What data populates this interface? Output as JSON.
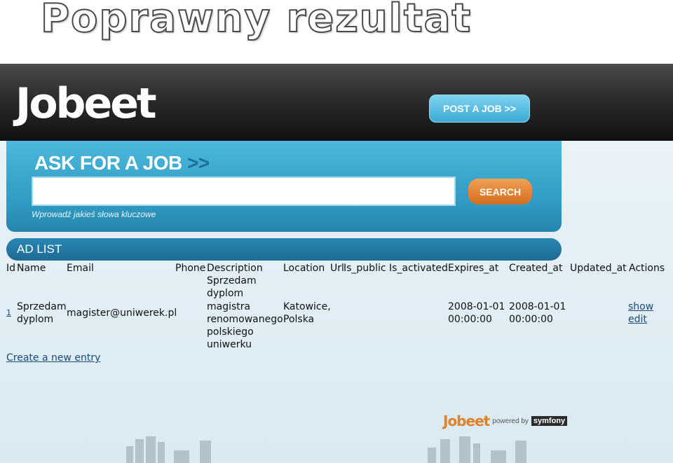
{
  "slide": {
    "title": "Poprawny rezultat"
  },
  "header": {
    "logo": "Jobeet",
    "post_job_label": "POST A JOB >>"
  },
  "search": {
    "title": "ASK FOR A JOB",
    "arrows": ">>",
    "input_value": "",
    "button_label": "SEARCH",
    "hint": "Wprowadź jakieś słowa kluczowe"
  },
  "ad_list": {
    "title": "AD LIST",
    "columns": [
      "Id",
      "Name",
      "Email",
      "Phone",
      "Description",
      "Location",
      "Url",
      "Is_public",
      "Is_activated",
      "Expires_at",
      "Created_at",
      "Updated_at",
      "Actions"
    ],
    "rows": [
      {
        "id": "1",
        "name_line1": "Sprzedam",
        "name_line2": "dyplom",
        "email": "magister@uniwerek.pl",
        "phone": "",
        "description_lines": [
          "Sprzedam",
          "dyplom",
          "magistra",
          "renomowanego",
          "polskiego",
          "uniwerku"
        ],
        "location_line1": "Katowice,",
        "location_line2": "Polska",
        "url": "",
        "is_public": "",
        "is_activated": "",
        "expires_line1": "2008-01-01",
        "expires_line2": "00:00:00",
        "created_line1": "2008-01-01",
        "created_line2": "00:00:00",
        "updated_at": "",
        "action_show": "show",
        "action_edit": "edit"
      }
    ],
    "create_link": "Create a new entry"
  },
  "footer": {
    "brand": "Jobeet",
    "powered_by": "powered by",
    "framework": "symfony"
  },
  "colors": {
    "header_dark": "#2c2c2c",
    "panel_blue": "#3aa8d2",
    "ad_bar_blue": "#1d6b95",
    "search_orange": "#e0822a",
    "link": "#1a4a7a"
  }
}
